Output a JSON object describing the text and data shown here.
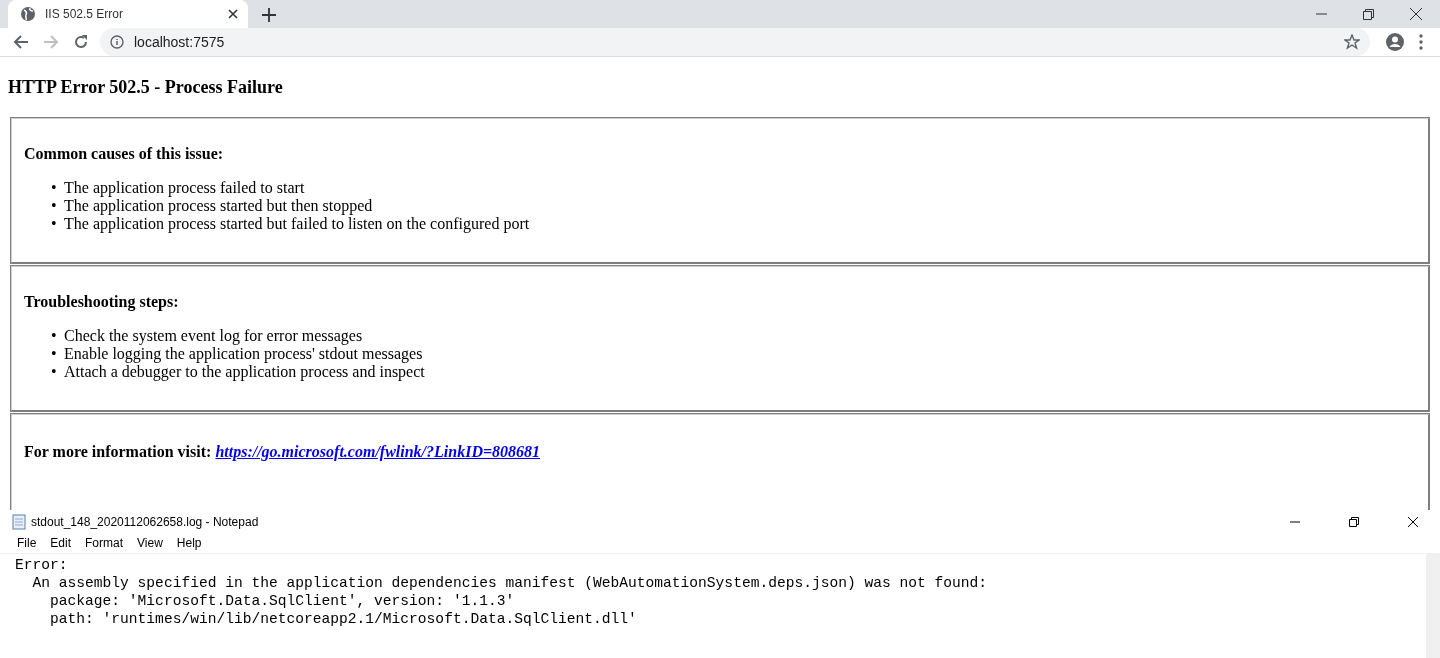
{
  "browser": {
    "tab_title": "IIS 502.5 Error",
    "address": "localhost:7575"
  },
  "page": {
    "heading": "HTTP Error 502.5 - Process Failure",
    "sections": [
      {
        "kind": "list",
        "title": "Common causes of this issue:",
        "marker": "•",
        "items": [
          "The application process failed to start",
          "The application process started but then stopped",
          "The application process started but failed to listen on the configured port"
        ]
      },
      {
        "kind": "list",
        "title": "Troubleshooting steps:",
        "marker": "•",
        "items": [
          "Check the system event log for error messages",
          "Enable logging the application process' stdout messages",
          "Attach a debugger to the application process and inspect"
        ]
      },
      {
        "kind": "link",
        "title": "For more information visit:",
        "link": "https://go.microsoft.com/fwlink/?LinkID=808681"
      }
    ]
  },
  "notepad": {
    "title": "stdout_148_2020112062658.log - Notepad",
    "menu": [
      "File",
      "Edit",
      "Format",
      "View",
      "Help"
    ],
    "lines": [
      "Error:",
      "  An assembly specified in the application dependencies manifest (WebAutomationSystem.deps.json) was not found:",
      "    package: 'Microsoft.Data.SqlClient', version: '1.1.3'",
      "    path: 'runtimes/win/lib/netcoreapp2.1/Microsoft.Data.SqlClient.dll'"
    ]
  }
}
